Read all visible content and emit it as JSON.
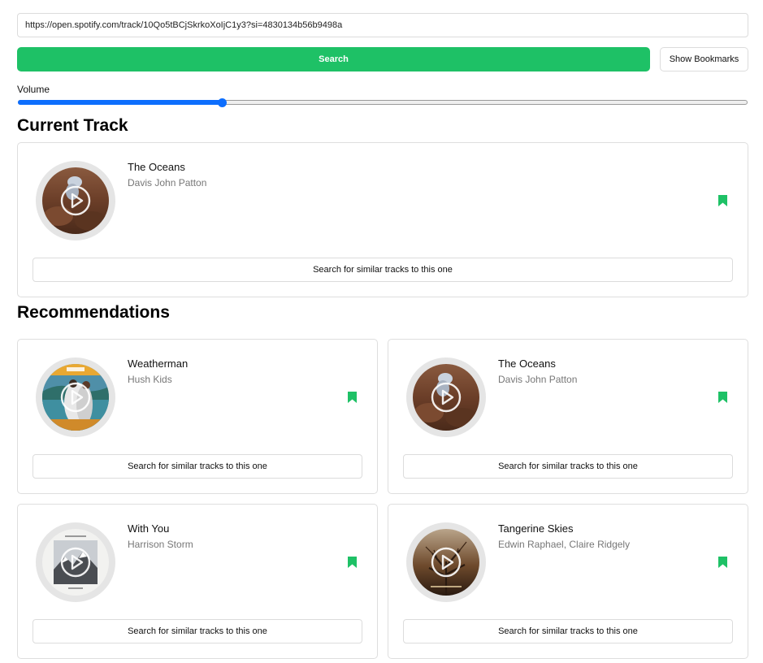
{
  "search": {
    "url_value": "https://open.spotify.com/track/10Qo5tBCjSkrkoXoIjC1y3?si=4830134b56b9498a",
    "button_label": "Search"
  },
  "bookmarks": {
    "button_label": "Show Bookmarks"
  },
  "volume": {
    "label": "Volume",
    "level": 0.28
  },
  "current_track": {
    "heading": "Current Track",
    "title": "The Oceans",
    "artist": "Davis John Patton",
    "cover_icon": "cover-oceans",
    "similar_label": "Search for similar tracks to this one"
  },
  "recommendations": {
    "heading": "Recommendations",
    "items": [
      {
        "title": "Weatherman",
        "artist": "Hush Kids",
        "cover_icon": "cover-weatherman",
        "similar_label": "Search for similar tracks to this one"
      },
      {
        "title": "The Oceans",
        "artist": "Davis John Patton",
        "cover_icon": "cover-oceans",
        "similar_label": "Search for similar tracks to this one"
      },
      {
        "title": "With You",
        "artist": "Harrison Storm",
        "cover_icon": "cover-with-you",
        "similar_label": "Search for similar tracks to this one"
      },
      {
        "title": "Tangerine Skies",
        "artist": "Edwin Raphael, Claire Ridgely",
        "cover_icon": "cover-tangerine-skies",
        "similar_label": "Search for similar tracks to this one"
      }
    ]
  },
  "colors": {
    "accent": "#1ec166",
    "slider": "#0d6efd",
    "bookmark": "#1ec166"
  }
}
